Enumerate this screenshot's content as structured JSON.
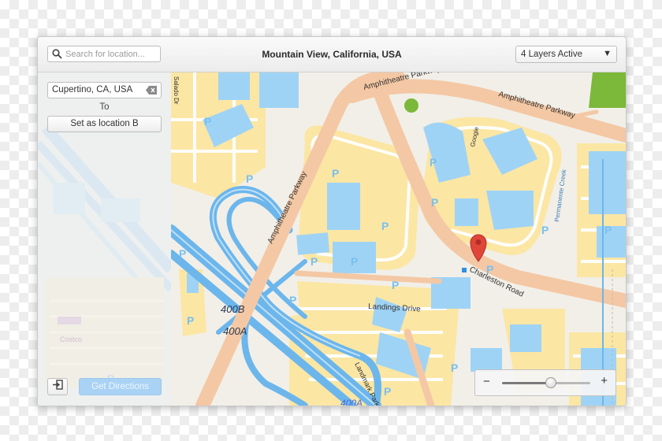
{
  "window": {
    "title": "Mountain View, California, USA"
  },
  "search": {
    "placeholder": "Search for location..."
  },
  "layers_dropdown": {
    "selected": "4 Layers Active"
  },
  "sidebar": {
    "location_a": "Cupertino, CA, USA",
    "to_label": "To",
    "set_b_label": "Set as location B",
    "directions_label": "Get Directions"
  },
  "map": {
    "labels": {
      "amphitheatre_top": "Amphitheatre Parkway",
      "amphitheatre_right": "Amphitheatre Parkway",
      "amphitheatre_diag": "Amphitheatre Parkway",
      "charleston": "Charleston Road",
      "landings": "Landings Drive",
      "landmark": "Landmark Parkway",
      "hwy_400b": "400B",
      "hwy_400a": "400A",
      "hwy_400a_bottom": "400A",
      "salado": "Salado Dr",
      "google": "Google",
      "permanente": "Permanente Creek",
      "costco": "Costco",
      "parking": "P"
    },
    "colors": {
      "background": "#f2efe8",
      "major_road": "#f4c8a4",
      "highway": "#6cb6ec",
      "building": "#9fd3f5",
      "parking_fill": "#fbe6a4",
      "park": "#7cb83a",
      "pin": "#e0453a"
    }
  },
  "zoom": {
    "minus": "−",
    "plus": "+",
    "level_fraction": 0.55
  },
  "icons": {
    "search": "search-icon",
    "clear": "clear-text-icon",
    "dropdown": "chevron-down-icon",
    "exit": "exit-icon",
    "pin": "map-pin-icon"
  }
}
